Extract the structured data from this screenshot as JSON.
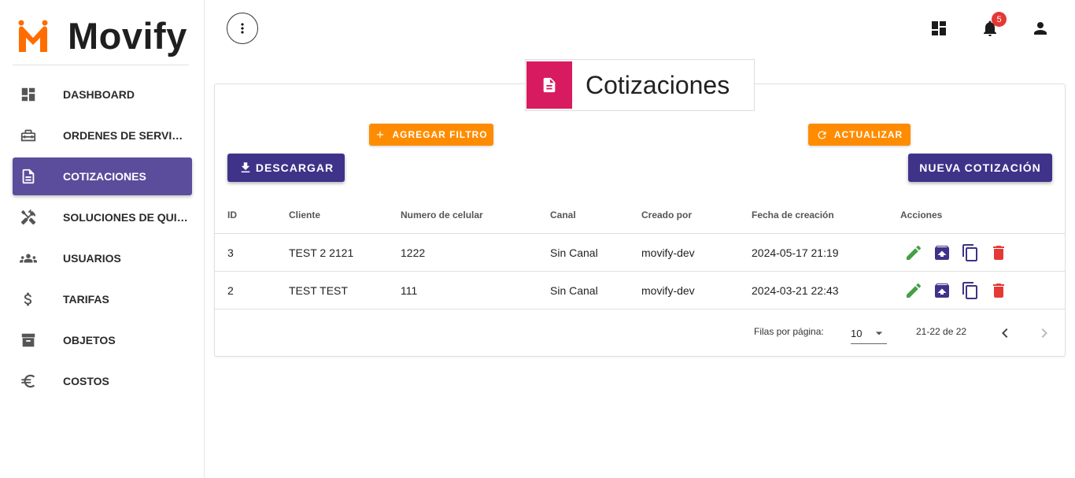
{
  "brand": {
    "name": "Movify",
    "logo_color": "#ff6d00"
  },
  "sidebar": {
    "items": [
      {
        "label": "DASHBOARD",
        "icon": "dashboard-icon",
        "active": false
      },
      {
        "label": "ORDENES DE SERVICIO",
        "icon": "toolbox-icon",
        "active": false
      },
      {
        "label": "COTIZACIONES",
        "icon": "document-icon",
        "active": true
      },
      {
        "label": "SOLUCIONES DE QUIEBRES",
        "icon": "tools-icon",
        "active": false
      },
      {
        "label": "USUARIOS",
        "icon": "group-icon",
        "active": false
      },
      {
        "label": "TARIFAS",
        "icon": "dollar-icon",
        "active": false
      },
      {
        "label": "OBJETOS",
        "icon": "archive-icon",
        "active": false
      },
      {
        "label": "COSTOS",
        "icon": "euro-icon",
        "active": false
      }
    ],
    "active_color": "#5c4c9c"
  },
  "topbar": {
    "notifications_count": "5",
    "icons": [
      "more-vert-icon",
      "dashboard-icon",
      "bell-icon",
      "person-icon"
    ]
  },
  "card": {
    "title": "Cotizaciones",
    "header_color": "#d81b60",
    "buttons": {
      "add_filter": "AGREGAR FILTRO",
      "refresh": "ACTUALIZAR",
      "download": "DESCARGAR",
      "new_quote": "NUEVA COTIZACIÓN"
    }
  },
  "table": {
    "columns": [
      "ID",
      "Cliente",
      "Numero de celular",
      "Canal",
      "Creado por",
      "Fecha de creación",
      "Acciones"
    ],
    "rows": [
      {
        "id": "3",
        "cliente": "TEST 2 2121",
        "celular": "1222",
        "canal": "Sin Canal",
        "creado_por": "movify-dev",
        "fecha": "2024-05-17 21:19"
      },
      {
        "id": "2",
        "cliente": "TEST TEST",
        "celular": "111",
        "canal": "Sin Canal",
        "creado_por": "movify-dev",
        "fecha": "2024-03-21 22:43"
      }
    ],
    "action_icons": [
      "edit-icon",
      "archive-upload-icon",
      "copy-icon",
      "delete-icon"
    ]
  },
  "pagination": {
    "rows_per_page_label": "Filas por página:",
    "rows_per_page": "10",
    "range": "21-22 de 22"
  }
}
